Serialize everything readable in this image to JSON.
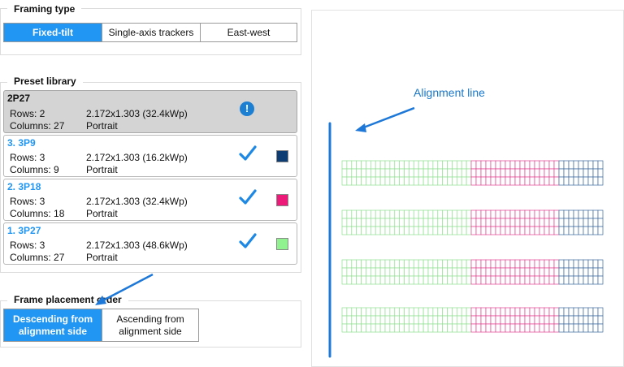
{
  "framing": {
    "title": "Framing type",
    "options": [
      "Fixed-tilt",
      "Single-axis trackers",
      "East-west"
    ],
    "selected": "Fixed-tilt"
  },
  "library": {
    "title": "Preset library",
    "presets": [
      {
        "name": "2P27",
        "rows": "Rows: 2",
        "cols": "Columns: 27",
        "size": "2.172x1.303 (32.4kWp)",
        "orient": "Portrait",
        "status": "warning",
        "selected": true
      },
      {
        "name": "3. 3P9",
        "rows": "Rows: 3",
        "cols": "Columns: 9",
        "size": "2.172x1.303 (16.2kWp)",
        "orient": "Portrait",
        "status": "check",
        "color": "#0d3d73"
      },
      {
        "name": "2. 3P18",
        "rows": "Rows: 3",
        "cols": "Columns: 18",
        "size": "2.172x1.303 (32.4kWp)",
        "orient": "Portrait",
        "status": "check",
        "color": "#ee1a7a"
      },
      {
        "name": "1. 3P27",
        "rows": "Rows: 3",
        "cols": "Columns: 27",
        "size": "2.172x1.303 (48.6kWp)",
        "orient": "Portrait",
        "status": "check",
        "color": "#8ff28f"
      }
    ]
  },
  "placement": {
    "title": "Frame placement order",
    "options": [
      "Descending from alignment side",
      "Ascending from alignment side"
    ],
    "selected": "Descending from alignment side"
  },
  "canvas": {
    "annotation": "Alignment line",
    "info_glyph": "!",
    "segment_colors": {
      "green": "#8fe08f",
      "pink": "#e0408f",
      "blue": "#3c6a9e"
    }
  }
}
